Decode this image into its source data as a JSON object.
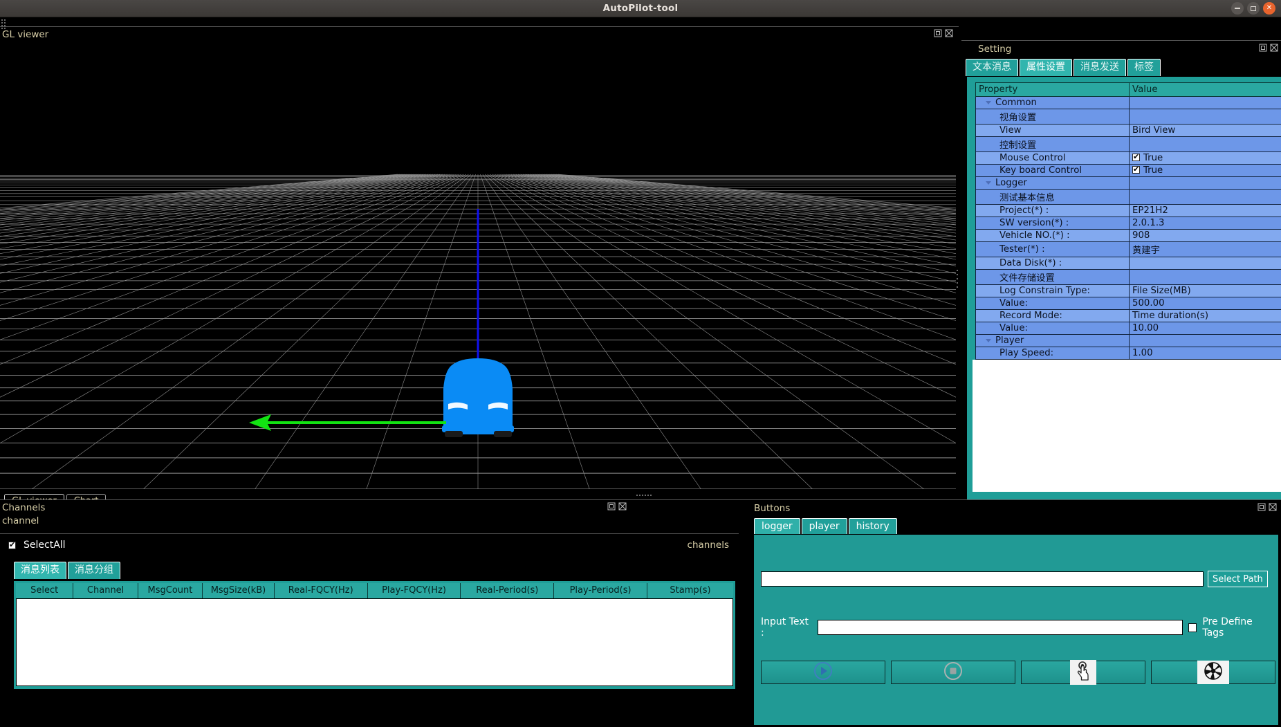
{
  "window": {
    "title": "AutoPilot-tool",
    "controls": [
      {
        "name": "minimize",
        "glyph": "minimize-icon"
      },
      {
        "name": "maximize",
        "glyph": "maximize-icon"
      },
      {
        "name": "close",
        "glyph": "close-icon"
      }
    ]
  },
  "gl_viewer": {
    "dock_title": "GL viewer",
    "dock_icons": [
      "float-icon",
      "close-icon"
    ],
    "tabs": [
      {
        "label": "GL viewer",
        "active": true
      },
      {
        "label": "Chart",
        "active": false
      }
    ],
    "scene": {
      "description": "3D perspective grid with blue vehicle model",
      "vehicle_color": "#0a8bf5",
      "z_axis_color": "#1010ee",
      "x_axis_color": "#12e312",
      "grid_color": "#9a9a9a",
      "background": "#000000"
    }
  },
  "setting": {
    "dock_title": "Setting",
    "dock_icons": [
      "float-icon",
      "close-icon"
    ],
    "tabs": [
      {
        "label": "文本消息",
        "active": false
      },
      {
        "label": "属性设置",
        "active": true
      },
      {
        "label": "消息发送",
        "active": false
      },
      {
        "label": "标签",
        "active": false
      }
    ],
    "table": {
      "headers": [
        "Property",
        "Value"
      ],
      "rows": [
        {
          "property": "Common",
          "value": "",
          "level": 0,
          "group": true,
          "caret": true,
          "checkbox": null
        },
        {
          "property": "视角设置",
          "value": "",
          "level": 2,
          "group": false,
          "caret": false,
          "checkbox": null
        },
        {
          "property": "View",
          "value": "Bird View",
          "level": 2,
          "group": false,
          "caret": false,
          "checkbox": null
        },
        {
          "property": "控制设置",
          "value": "",
          "level": 2,
          "group": false,
          "caret": false,
          "checkbox": null
        },
        {
          "property": "Mouse Control",
          "value": "True",
          "level": 2,
          "group": false,
          "caret": false,
          "checkbox": true
        },
        {
          "property": "Key board Control",
          "value": "True",
          "level": 2,
          "group": false,
          "caret": false,
          "checkbox": true
        },
        {
          "property": "Logger",
          "value": "",
          "level": 0,
          "group": true,
          "caret": true,
          "checkbox": null
        },
        {
          "property": "测试基本信息",
          "value": "",
          "level": 2,
          "group": false,
          "caret": false,
          "checkbox": null
        },
        {
          "property": "Project(*) :",
          "value": "EP21H2",
          "level": 2,
          "group": false,
          "caret": false,
          "checkbox": null
        },
        {
          "property": "SW version(*) :",
          "value": "2.0.1.3",
          "level": 2,
          "group": false,
          "caret": false,
          "checkbox": null
        },
        {
          "property": "Vehicle NO.(*) :",
          "value": "908",
          "level": 2,
          "group": false,
          "caret": false,
          "checkbox": null
        },
        {
          "property": "Tester(*) :",
          "value": "黄建宇",
          "level": 2,
          "group": false,
          "caret": false,
          "checkbox": null
        },
        {
          "property": "Data Disk(*) :",
          "value": "",
          "level": 2,
          "group": false,
          "caret": false,
          "checkbox": null
        },
        {
          "property": "文件存储设置",
          "value": "",
          "level": 2,
          "group": false,
          "caret": false,
          "checkbox": null
        },
        {
          "property": "Log Constrain Type:",
          "value": "File Size(MB)",
          "level": 2,
          "group": false,
          "caret": false,
          "checkbox": null
        },
        {
          "property": "Value:",
          "value": "500.00",
          "level": 2,
          "group": false,
          "caret": false,
          "checkbox": null
        },
        {
          "property": "Record Mode:",
          "value": "Time duration(s)",
          "level": 2,
          "group": false,
          "caret": false,
          "checkbox": null
        },
        {
          "property": "Value:",
          "value": "10.00",
          "level": 2,
          "group": false,
          "caret": false,
          "checkbox": null
        },
        {
          "property": "Player",
          "value": "",
          "level": 0,
          "group": true,
          "caret": true,
          "checkbox": null
        },
        {
          "property": "Play Speed:",
          "value": "1.00",
          "level": 2,
          "group": false,
          "caret": false,
          "checkbox": null
        }
      ]
    }
  },
  "channels": {
    "dock_title": "Channels",
    "subtitle": "channel",
    "right_label": "channels",
    "dock_icons": [
      "float-icon",
      "close-icon"
    ],
    "select_all": {
      "label": "SelectAll",
      "checked": true
    },
    "tabs": [
      {
        "label": "消息列表",
        "active": true
      },
      {
        "label": "消息分组",
        "active": false
      }
    ],
    "table": {
      "headers": [
        "Select",
        "Channel",
        "MsgCount",
        "MsgSize(kB)",
        "Real-FQCY(Hz)",
        "Play-FQCY(Hz)",
        "Real-Period(s)",
        "Play-Period(s)",
        "Stamp(s)"
      ],
      "rows": []
    }
  },
  "buttons_panel": {
    "dock_title": "Buttons",
    "dock_icons": [
      "float-icon",
      "close-icon"
    ],
    "tabs": [
      {
        "label": "logger",
        "active": true
      },
      {
        "label": "player",
        "active": false
      },
      {
        "label": "history",
        "active": false
      }
    ],
    "path_input": {
      "value": "",
      "placeholder": ""
    },
    "select_path_label": "Select Path",
    "input_text_label": "Input Text :",
    "input_text": {
      "value": "",
      "placeholder": ""
    },
    "pre_define_tags": {
      "label": "Pre Define Tags",
      "checked": false
    },
    "action_buttons": [
      {
        "name": "start-record-button",
        "icon": "play-circle-icon",
        "label": ""
      },
      {
        "name": "stop-record-button",
        "icon": "stop-circle-icon",
        "label": ""
      },
      {
        "name": "tag-click-button",
        "icon": "hand-pointer-icon",
        "label": ""
      },
      {
        "name": "snapshot-button",
        "icon": "camera-aperture-icon",
        "label": ""
      }
    ]
  },
  "colors": {
    "teal": "#1f9e98",
    "teal_light": "#2fb0a9",
    "row_blue": "#82a9ef",
    "row_blue_alt": "#6d97e8",
    "title_text": "#d8cfa8",
    "accent_close": "#e8642d"
  }
}
